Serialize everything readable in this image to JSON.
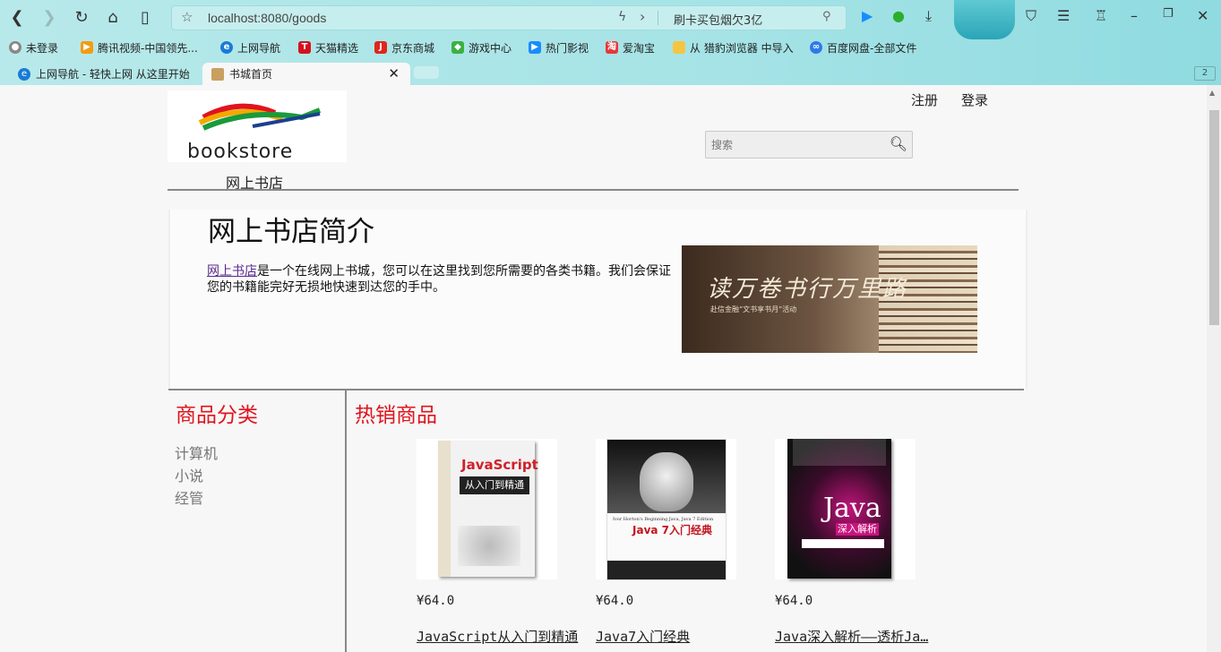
{
  "browser": {
    "url": "localhost:8080/goods",
    "hot_search": "刷卡买包烟欠3亿",
    "bookmarks": [
      {
        "label": "未登录"
      },
      {
        "label": "腾讯视频-中国领先..."
      },
      {
        "label": "上网导航"
      },
      {
        "label": "天猫精选"
      },
      {
        "label": "京东商城"
      },
      {
        "label": "游戏中心"
      },
      {
        "label": "热门影视"
      },
      {
        "label": "爱淘宝"
      },
      {
        "label": "从 猎豹浏览器 中导入"
      },
      {
        "label": "百度网盘-全部文件"
      }
    ],
    "tabs": [
      {
        "label": "上网导航 - 轻快上网 从这里开始"
      },
      {
        "label": "书城首页"
      }
    ],
    "tab_count": "2"
  },
  "page": {
    "logo_text": "bookstore",
    "site_name": "网上书店",
    "nav": {
      "register": "注册",
      "login": "登录"
    },
    "search_placeholder": "搜索",
    "intro": {
      "title": "网上书店简介",
      "link_text": "网上书店",
      "body": "是一个在线网上书城，您可以在这里找到您所需要的各类书籍。我们会保证您的书籍能完好无损地快速到达您的手中。",
      "banner_text": "读万卷书行万里路",
      "banner_sub": "赴信金融“文书享书月”活动"
    },
    "categories": {
      "title": "商品分类",
      "items": [
        "计算机",
        "小说",
        "经管"
      ]
    },
    "hot": {
      "title": "热销商品",
      "books": [
        {
          "price": "¥64.0",
          "name": "JavaScript从入门到精通",
          "cover_title": "JavaScript",
          "cover_sub": "从入门到精通"
        },
        {
          "price": "¥64.0",
          "name": "Java7入门经典",
          "cover_title": "Java 7入门经典",
          "cover_sub": "Ivor Horton's Beginning Java, Java 7 Edition"
        },
        {
          "price": "¥64.0",
          "name": "Java深入解析——透析Ja…",
          "cover_title": "Java",
          "cover_sub": "深入解析"
        }
      ]
    }
  },
  "colors": {
    "accent_red": "#e0141e",
    "browser_bar": "#a5e3e6"
  }
}
